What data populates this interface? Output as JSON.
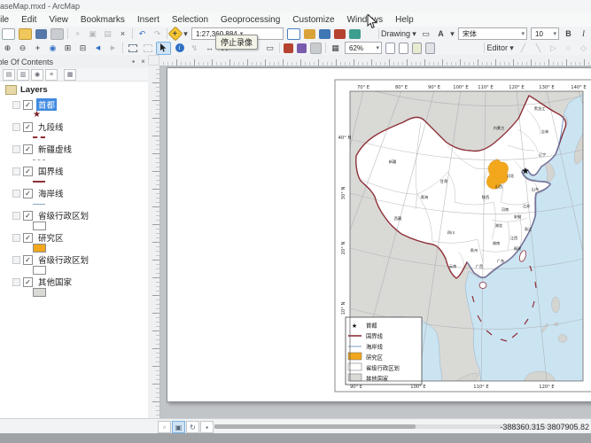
{
  "window": {
    "title": "BaseMap.mxd - ArcMap"
  },
  "menu": [
    "File",
    "Edit",
    "View",
    "Bookmarks",
    "Insert",
    "Selection",
    "Geoprocessing",
    "Customize",
    "Windows",
    "Help"
  ],
  "toolbars": {
    "scale": "1:27,360,884",
    "drawing_label": "Drawing",
    "font_name": "宋体",
    "font_size": "10",
    "bold": "B",
    "italic": "I",
    "layout_zoom": "62%",
    "editor_label": "Editor",
    "recording_tooltip": "停止录像"
  },
  "icons": {
    "caret": "▾",
    "check": "✓",
    "close": "×",
    "pin": "▪",
    "star": "★",
    "cut": "×",
    "copy": "▣",
    "paste": "▤",
    "del": "×",
    "undo": "↶",
    "redo": "↷",
    "add_data": "+",
    "zoom_in": "⊕",
    "zoom_out": "⊖",
    "pan": "+",
    "full_extent": "◉",
    "fixed_in": "⊞",
    "fixed_out": "⊟",
    "back": "◀",
    "fwd": "▶",
    "identify": "i",
    "hyperlink": "↯",
    "measure": "↔",
    "find": "A",
    "xy": "XY",
    "time": "◔",
    "viewer": "▭",
    "grid": "▦",
    "toc_tools": [
      "▤",
      "▥",
      "◉",
      "≡",
      "▦"
    ],
    "editor_tools": [
      "╱",
      "╲",
      "▷",
      "○",
      "◇"
    ],
    "view_buttons": [
      "▫",
      "▣",
      "↻",
      "▪"
    ]
  },
  "toc": {
    "title": "Table Of Contents",
    "root_label": "Layers",
    "layers": [
      {
        "label": "首都",
        "symbol": "star",
        "selected": true,
        "checked": true
      },
      {
        "label": "九段线",
        "symbol": "red-dash",
        "checked": true
      },
      {
        "label": "新疆虚线",
        "symbol": "gray-dash",
        "checked": true
      },
      {
        "label": "国界线",
        "symbol": "darkred-line",
        "checked": true
      },
      {
        "label": "海岸线",
        "symbol": "blue-line",
        "checked": true
      },
      {
        "label": "省级行政区划",
        "symbol": "white-fill",
        "checked": true
      },
      {
        "label": "研究区",
        "symbol": "orange-fill",
        "checked": true
      },
      {
        "label": "省级行政区划",
        "symbol": "white-fill",
        "checked": true
      },
      {
        "label": "其他国家",
        "symbol": "gray-fill",
        "checked": true
      }
    ]
  },
  "map": {
    "top_lons": [
      "70° E",
      "80° E",
      "90° E",
      "100° E",
      "110° E",
      "120° E",
      "130° E",
      "140° E"
    ],
    "bottom_lons": [
      "90° E",
      "100° E",
      "110° E",
      "120° E"
    ],
    "left_lats": [
      "40° N",
      "30° N",
      "20° N",
      "10° N"
    ],
    "legend": {
      "items": [
        {
          "label": "首都"
        },
        {
          "label": "国界线"
        },
        {
          "label": "海岸线"
        },
        {
          "label": "研究区"
        },
        {
          "label": "省级行政区划"
        },
        {
          "label": "其他国家"
        }
      ]
    },
    "province_labels": [
      "新疆",
      "西藏",
      "青海",
      "甘肃",
      "内蒙古",
      "黑龙江",
      "吉林",
      "辽宁",
      "河北",
      "山西",
      "陕西",
      "河南",
      "山东",
      "江苏",
      "安徽",
      "湖北",
      "四川",
      "湖南",
      "江西",
      "浙江",
      "福建",
      "贵州",
      "云南",
      "广西",
      "广东"
    ]
  },
  "status": {
    "coords": "-388360.315  3807905.82"
  },
  "colors": {
    "national_boundary": "#8e3038",
    "study_area": "#f2a71c",
    "ocean": "#cbe4f2",
    "other_countries": "#d9d9d6",
    "coastline": "#5a87c0",
    "selection": "#3f8ae0"
  }
}
